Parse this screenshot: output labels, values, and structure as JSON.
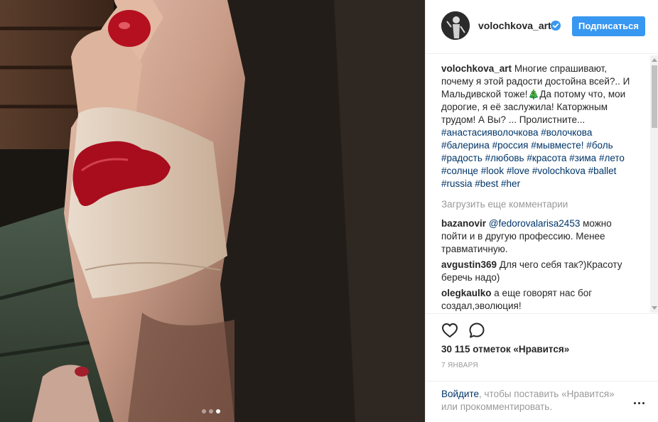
{
  "post": {
    "author": "volochkova_art",
    "follow_label": "Подписаться",
    "caption_text": "Многие спрашивают, почему я этой радости достойна всей?.. И Мальдивской тоже!🎄Да потому что, мои дорогие, я её заслужила! Каторжным трудом! А Вы? ... Пролистните...",
    "hashtags": "#анастасияволочкова #волочкова #балерина #россия #мывместе! #боль #радость #любовь #красота #зима #лето #солнце #look #love #volochkova #ballet #russia #best #her",
    "load_more": "Загрузить еще комментарии",
    "comments": [
      {
        "user": "bazanovir",
        "mention": "@fedorovalarisa2453",
        "text": "можно пойти и в другую профессию. Менее травматичную."
      },
      {
        "user": "avgustin369",
        "text": "Для чего себя так?)Красоту беречь надо)"
      },
      {
        "user": "olegkaulko",
        "text": "а еще говорят нас бог создал,эволюция!"
      }
    ],
    "likes": "30 115 отметок «Нравится»",
    "date": "7 ЯНВАРЯ",
    "footer": {
      "login_link": "Войдите",
      "login_text": ", чтобы поставить «Нравится» или прокомментировать."
    },
    "carousel": {
      "count": 3,
      "active_index": 2
    }
  },
  "icons": {
    "verified": "verified-badge-icon",
    "like": "heart-icon",
    "comment": "comment-bubble-icon",
    "more": "more-options-icon"
  },
  "colors": {
    "accent": "#3897f0",
    "link": "#003569",
    "muted": "#999999",
    "text": "#262626"
  }
}
